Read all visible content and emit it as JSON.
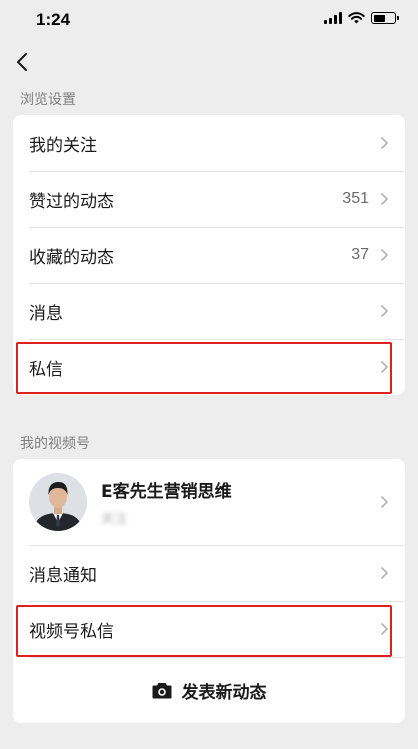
{
  "status_bar": {
    "time": "1:24"
  },
  "browse_section": {
    "title": "浏览设置",
    "items": [
      {
        "label": "我的关注",
        "count": ""
      },
      {
        "label": "赞过的动态",
        "count": "351"
      },
      {
        "label": "收藏的动态",
        "count": "37"
      },
      {
        "label": "消息",
        "count": ""
      },
      {
        "label": "私信",
        "count": ""
      }
    ]
  },
  "channel_section": {
    "title": "我的视频号",
    "profile": {
      "name": "E客先生营销思维",
      "subtitle": "关注"
    },
    "items": [
      {
        "label": "消息通知"
      },
      {
        "label": "视频号私信"
      }
    ],
    "post_button": {
      "label": "发表新动态",
      "icon": "camera-icon"
    }
  },
  "colors": {
    "highlight": "#e02020",
    "background": "#ededed"
  }
}
